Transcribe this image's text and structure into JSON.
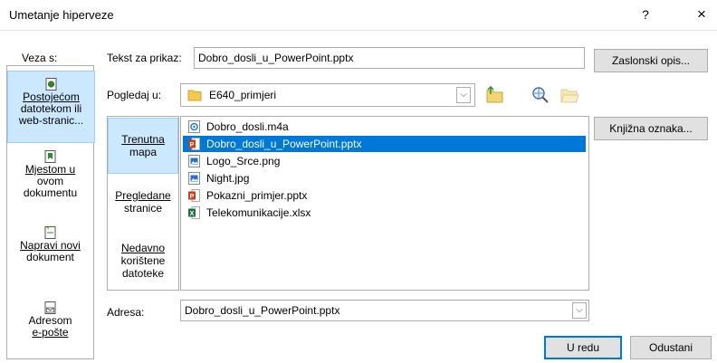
{
  "dialog": {
    "title": "Umetanje hiperveze",
    "help": "?",
    "close": "×"
  },
  "link_to": {
    "label": "Veza s:",
    "items": [
      {
        "l1": "Postojećom",
        "l2": "datotekom ili",
        "l3": "web-stranic..."
      },
      {
        "l1": "Mjestom u",
        "l2": "ovom",
        "l3": "dokumentu"
      },
      {
        "l1": "Napravi novi",
        "l2": "dokument"
      },
      {
        "l1": "Adresom",
        "l2": "e-pošte"
      }
    ]
  },
  "text_to_display": {
    "label": "Tekst za prikaz:",
    "value": "Dobro_dosli_u_PowerPoint.pptx"
  },
  "screentip_button": "Zaslonski opis...",
  "look_in": {
    "label": "Pogledaj u:",
    "value": "E640_primjeri"
  },
  "bookmark_button": "Knjižna oznaka...",
  "sub_nav": [
    {
      "l1": "Trenutna",
      "l2": "mapa"
    },
    {
      "l1": "Pregledane",
      "l2": "stranice"
    },
    {
      "l1": "Nedavno",
      "l2": "korištene",
      "l3": "datoteke"
    }
  ],
  "files": [
    {
      "name": "Dobro_dosli.m4a",
      "icon": "audio-file-icon",
      "color": "#1e7bd6"
    },
    {
      "name": "Dobro_dosli_u_PowerPoint.pptx",
      "icon": "powerpoint-file-icon",
      "color": "#c9401f"
    },
    {
      "name": "Logo_Srce.png",
      "icon": "image-file-icon",
      "color": "#2a6fc9"
    },
    {
      "name": "Night.jpg",
      "icon": "image-file-icon",
      "color": "#2a6fc9"
    },
    {
      "name": "Pokazni_primjer.pptx",
      "icon": "powerpoint-file-icon",
      "color": "#c9401f"
    },
    {
      "name": "Telekomunikacije.xlsx",
      "icon": "excel-file-icon",
      "color": "#1e7145"
    }
  ],
  "address": {
    "label": "Adresa:",
    "value": "Dobro_dosli_u_PowerPoint.pptx"
  },
  "ok_button": "U redu",
  "cancel_button": "Odustani",
  "colors": {
    "selection": "#0078d7",
    "nav_selected": "#cce8ff",
    "button_face": "#e1e1e1",
    "border": "#adadad"
  }
}
